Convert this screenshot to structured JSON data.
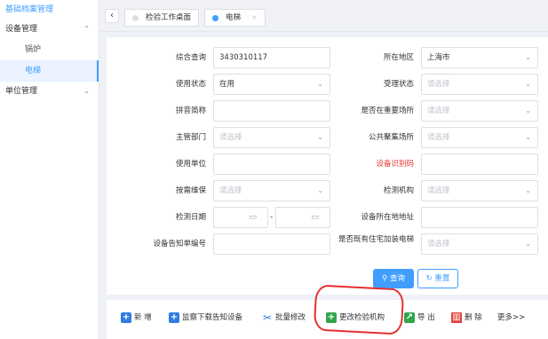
{
  "sidebar": {
    "top": "基础档案管理",
    "group1": "设备管理",
    "items": [
      {
        "label": "锅炉"
      },
      {
        "label": "电梯"
      }
    ],
    "group2": "单位管理"
  },
  "tabs": [
    {
      "label": "检验工作桌面",
      "dot": "#dcdfe6"
    },
    {
      "label": "电梯",
      "dot": "#409eff",
      "close": "×"
    }
  ],
  "form": {
    "zhcx": {
      "label": "综合查询",
      "value": "3430310117"
    },
    "szdq": {
      "label": "所在地区",
      "value": "上海市"
    },
    "syzt": {
      "label": "使用状态",
      "value": "在用"
    },
    "slzt": {
      "label": "受理状态",
      "placeholder": "请选择"
    },
    "pyjc": {
      "label": "拼音简称",
      "value": ""
    },
    "sfzzycs": {
      "label": "是否在重要场所",
      "placeholder": "请选择"
    },
    "zgbm": {
      "label": "主管部门",
      "placeholder": "请选择"
    },
    "ggjjcs": {
      "label": "公共聚集场所",
      "placeholder": "请选择"
    },
    "sydw": {
      "label": "使用单位",
      "value": ""
    },
    "sbsbm": {
      "label": "设备识别码",
      "value": ""
    },
    "afwb": {
      "label": "按需维保",
      "placeholder": "请选择"
    },
    "jcjg": {
      "label": "检测机构",
      "placeholder": "请选择"
    },
    "jcrq": {
      "label": "检测日期",
      "sep": "-"
    },
    "sbszdz": {
      "label": "设备所在地地址",
      "value": ""
    },
    "sbgzdbh": {
      "label": "设备告知单编号",
      "value": ""
    },
    "sfjyzz": {
      "label": "是否既有住宅加装电梯",
      "placeholder": "请选择"
    }
  },
  "buttons": {
    "query": "查询",
    "reset": "重置"
  },
  "toolbar": {
    "add": "新 增",
    "download": "监察下载告知设备",
    "batch": "批量修改",
    "change": "更改检验机构",
    "export": "导 出",
    "delete": "删 除",
    "more": "更多>>"
  },
  "icons": {
    "chevron": "⌄",
    "back": "‹",
    "calendar": "▭",
    "search": "⚲",
    "refresh": "↻"
  }
}
